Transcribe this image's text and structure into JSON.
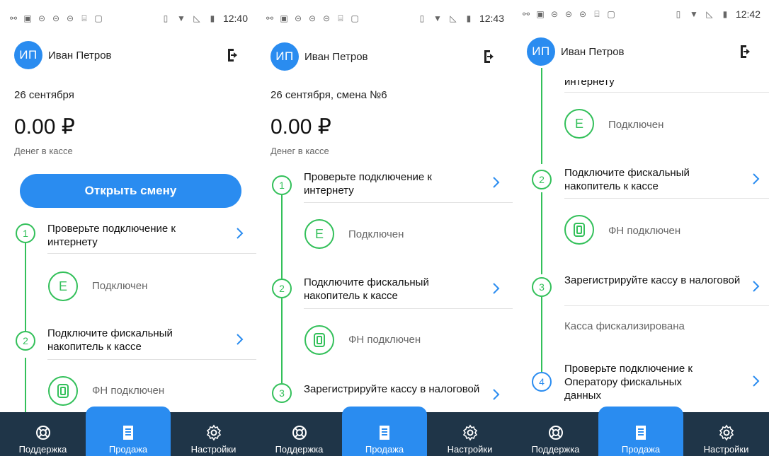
{
  "screens": [
    {
      "status_time": "12:40",
      "avatar_initials": "ИП",
      "user_name": "Иван Петров",
      "date_text": "26 сентября",
      "amount": "0.00 ₽",
      "cash_label": "Денег в кассе",
      "open_shift_label": "Открыть смену",
      "steps": [
        {
          "number": "1",
          "title": "Проверьте подключение к интернету",
          "status_icon_letter": "E",
          "status_text": "Подключен"
        },
        {
          "number": "2",
          "title": "Подключите фискальный накопитель к кассе",
          "status_text": "ФН подключен"
        }
      ]
    },
    {
      "status_time": "12:43",
      "avatar_initials": "ИП",
      "user_name": "Иван Петров",
      "date_text": "26 сентября, смена №6",
      "amount": "0.00 ₽",
      "cash_label": "Денег в кассе",
      "steps": [
        {
          "number": "1",
          "title": "Проверьте подключение к интернету",
          "status_icon_letter": "E",
          "status_text": "Подключен"
        },
        {
          "number": "2",
          "title": "Подключите фискальный накопитель к кассе",
          "status_text": "ФН подключен"
        },
        {
          "number": "3",
          "title": "Зарегистрируйте кассу в налоговой"
        }
      ]
    },
    {
      "status_time": "12:42",
      "avatar_initials": "ИП",
      "user_name": "Иван Петров",
      "cut_text": "интернету",
      "steps": [
        {
          "status_icon_letter": "E",
          "status_text": "Подключен"
        },
        {
          "number": "2",
          "title": "Подключите фискальный накопитель к кассе",
          "status_text": "ФН подключен"
        },
        {
          "number": "3",
          "title": "Зарегистрируйте кассу в налоговой",
          "status_text": "Касса фискализирована"
        },
        {
          "number": "4",
          "title": "Проверьте подключение к Оператору фискальных данных"
        }
      ]
    }
  ],
  "nav": {
    "support": "Поддержка",
    "sale": "Продажа",
    "settings": "Настройки"
  },
  "colors": {
    "accent": "#2a8cf0",
    "success": "#33c05a",
    "nav_bg": "#1f3548"
  }
}
